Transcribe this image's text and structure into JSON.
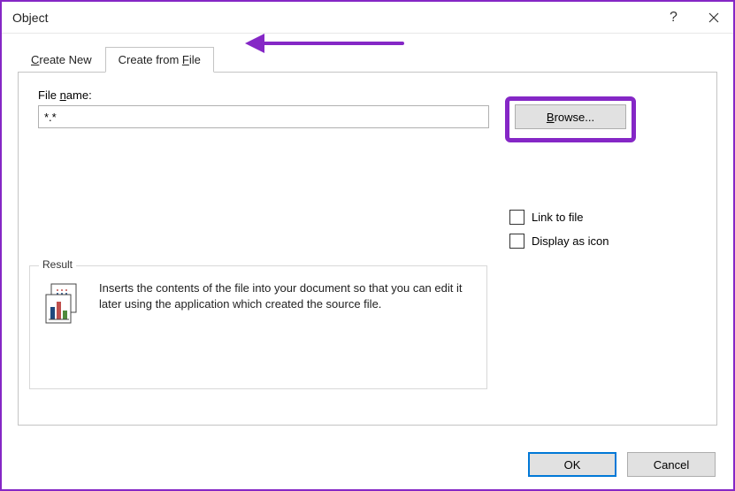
{
  "titlebar": {
    "title": "Object"
  },
  "tabs": {
    "create_new_pre": "",
    "create_new_u": "C",
    "create_new_post": "reate New",
    "create_from_file_pre": "Create from ",
    "create_from_file_u": "F",
    "create_from_file_post": "ile"
  },
  "file": {
    "label_pre": "File ",
    "label_u": "n",
    "label_post": "ame:",
    "value": "*.*",
    "browse_pre": "",
    "browse_u": "B",
    "browse_post": "rowse..."
  },
  "checks": {
    "link": "Link to file",
    "display_icon": "Display as icon"
  },
  "result": {
    "legend": "Result",
    "text": "Inserts the contents of the file into your document so that you can edit it later using the application which created the source file."
  },
  "footer": {
    "ok": "OK",
    "cancel": "Cancel"
  },
  "annotation": {
    "color": "#8527c6"
  }
}
